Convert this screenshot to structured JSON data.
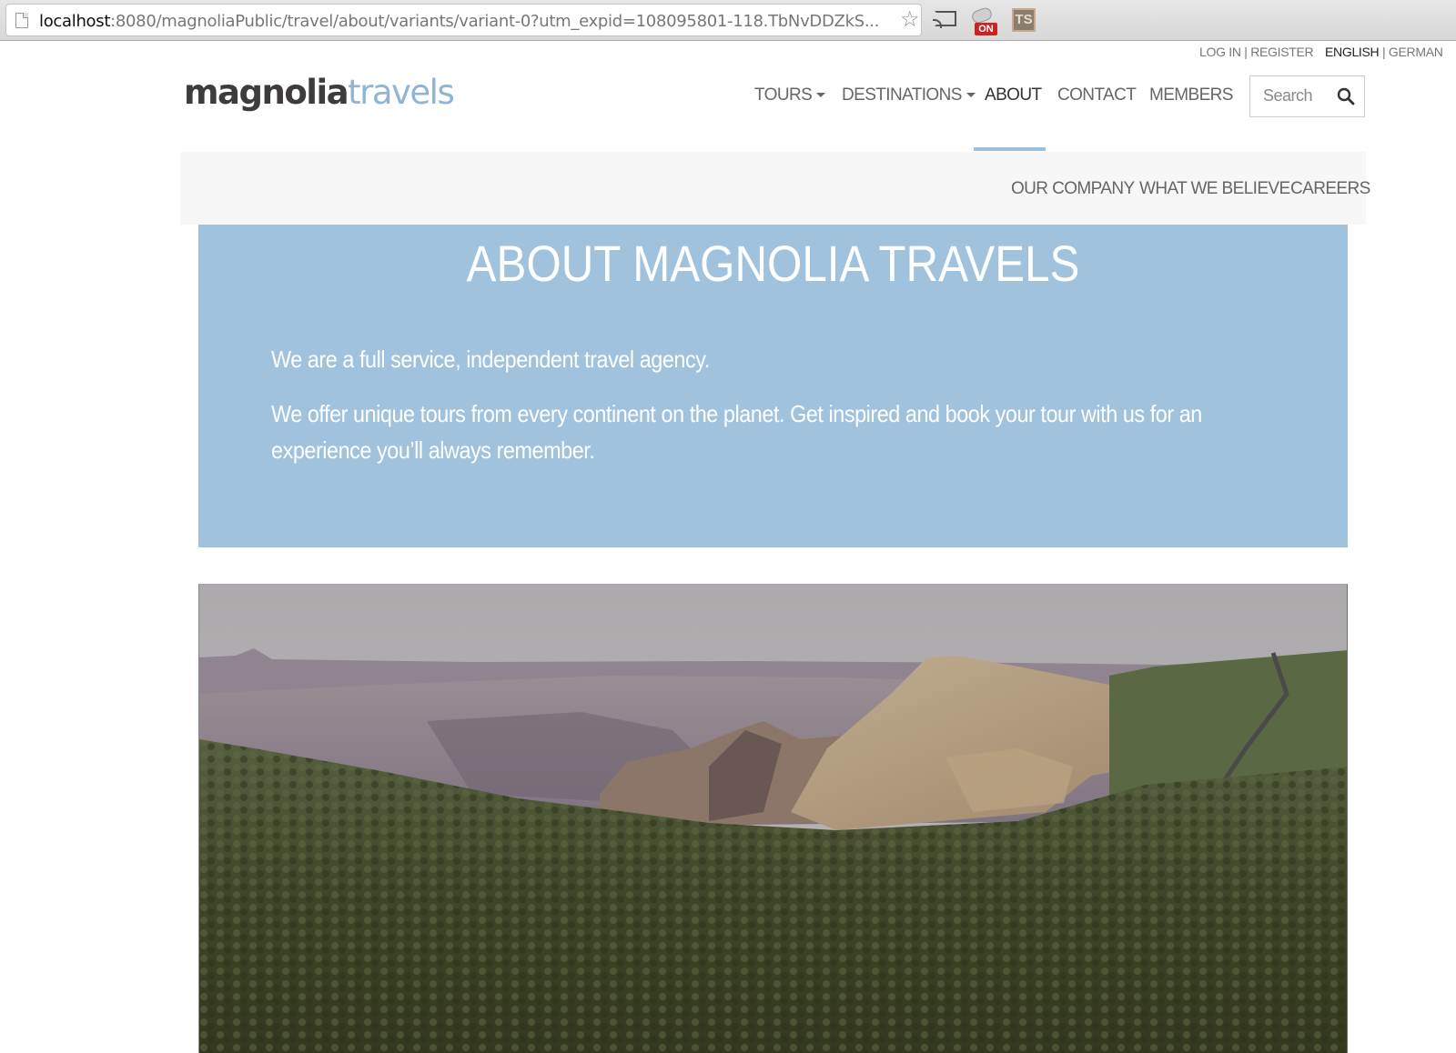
{
  "browser": {
    "url_host": "localhost",
    "url_rest": ":8080/magnoliaPublic/travel/about/variants/variant-0?utm_expid=108095801-118.TbNvDDZkS...",
    "extensions": [
      {
        "name": "cast",
        "label": ""
      },
      {
        "name": "toggle",
        "badge": "ON"
      },
      {
        "name": "ts",
        "label": "TS"
      }
    ]
  },
  "utility": {
    "login": "LOG IN",
    "separator": "|",
    "register": "REGISTER",
    "lang_english": "ENGLISH",
    "lang_german": "GERMAN"
  },
  "logo": {
    "part1": "magnolia",
    "part2": "travels"
  },
  "nav": {
    "items": [
      {
        "label": "TOURS",
        "dropdown": true
      },
      {
        "label": "DESTINATIONS",
        "dropdown": true
      },
      {
        "label": "ABOUT",
        "active": true
      },
      {
        "label": "CONTACT"
      },
      {
        "label": "MEMBERS"
      }
    ],
    "search_placeholder": "Search"
  },
  "subnav": {
    "items": [
      {
        "label": "OUR COMPANY"
      },
      {
        "label": "WHAT WE BELIEVE"
      },
      {
        "label": "CAREERS"
      }
    ]
  },
  "hero": {
    "title": "ABOUT MAGNOLIA TRAVELS",
    "paragraphs": [
      "We are a full service, independent travel agency.",
      "We offer unique tours from every continent on the planet. Get inspired and book your tour with us for an experience you’ll always remember."
    ]
  },
  "photo": {
    "subject": "canyon-landscape"
  },
  "colors": {
    "accent_blue": "#a0c2dd",
    "logo_blue": "#8fb4d4",
    "nav_text": "#666666",
    "subnav_bg": "#f7f7f7"
  }
}
